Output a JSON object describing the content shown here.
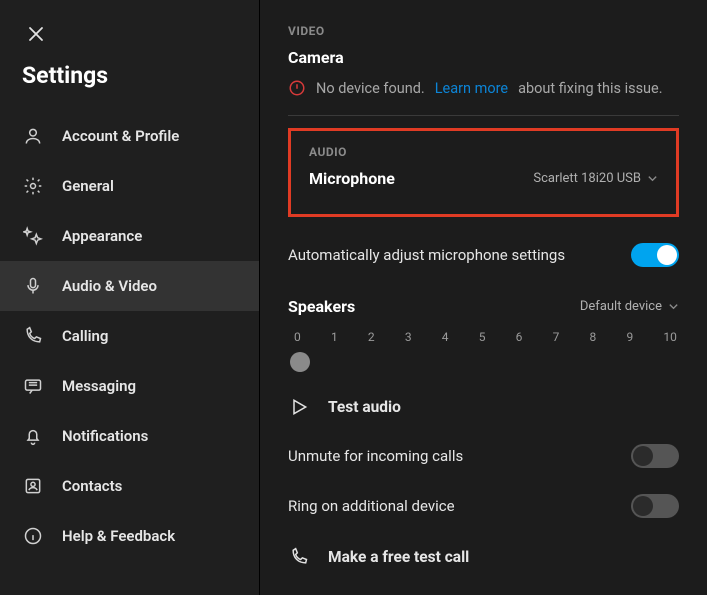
{
  "sidebar": {
    "title": "Settings",
    "items": [
      {
        "label": "Account & Profile"
      },
      {
        "label": "General"
      },
      {
        "label": "Appearance"
      },
      {
        "label": "Audio & Video"
      },
      {
        "label": "Calling"
      },
      {
        "label": "Messaging"
      },
      {
        "label": "Notifications"
      },
      {
        "label": "Contacts"
      },
      {
        "label": "Help & Feedback"
      }
    ]
  },
  "content": {
    "video": {
      "section": "VIDEO",
      "title": "Camera",
      "no_device_pre": "No device found.",
      "learn_more": "Learn more",
      "no_device_post": "about fixing this issue."
    },
    "audio": {
      "section": "AUDIO",
      "microphone_label": "Microphone",
      "microphone_value": "Scarlett 18i20 USB",
      "auto_adjust_label": "Automatically adjust microphone settings",
      "auto_adjust_on": true,
      "speakers_label": "Speakers",
      "speakers_value": "Default device",
      "scale": [
        "0",
        "1",
        "2",
        "3",
        "4",
        "5",
        "6",
        "7",
        "8",
        "9",
        "10"
      ],
      "volume_position": 0,
      "test_audio": "Test audio",
      "unmute_label": "Unmute for incoming calls",
      "unmute_on": false,
      "ring_label": "Ring on additional device",
      "ring_on": false,
      "test_call": "Make a free test call"
    }
  }
}
